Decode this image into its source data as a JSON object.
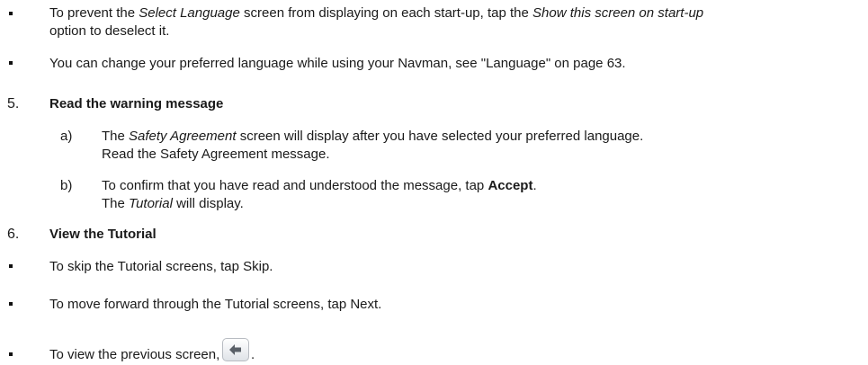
{
  "bullets_top": [
    {
      "line1_a": "To prevent the ",
      "line1_em1": "Select Language",
      "line1_b": " screen from displaying on each start-up, tap the ",
      "line1_em2": "Show this screen on start-up",
      "line2": "option to deselect it."
    },
    {
      "text": "You can change your preferred language while using your Navman, see \"Language\" on page 63."
    }
  ],
  "step5": {
    "number": "5.",
    "title": "Read the warning message",
    "items": [
      {
        "marker": "a)",
        "line1_a": "The ",
        "line1_em": "Safety Agreement",
        "line1_b": " screen will display after you have selected your preferred language.",
        "line2": "Read the Safety Agreement message."
      },
      {
        "marker": "b)",
        "line1_a": "To confirm that you have read and understood the message, tap ",
        "line1_strong": "Accept",
        "line1_b": ".",
        "line2_a": "The ",
        "line2_em": "Tutorial",
        "line2_b": " will display."
      }
    ]
  },
  "step6": {
    "number": "6.",
    "title": "View the Tutorial",
    "bullets": [
      "To skip the Tutorial screens, tap Skip.",
      "To move forward through the Tutorial screens, tap Next.",
      "To view the previous screen, tap",
      "."
    ],
    "back_icon": "back-arrow-icon"
  }
}
